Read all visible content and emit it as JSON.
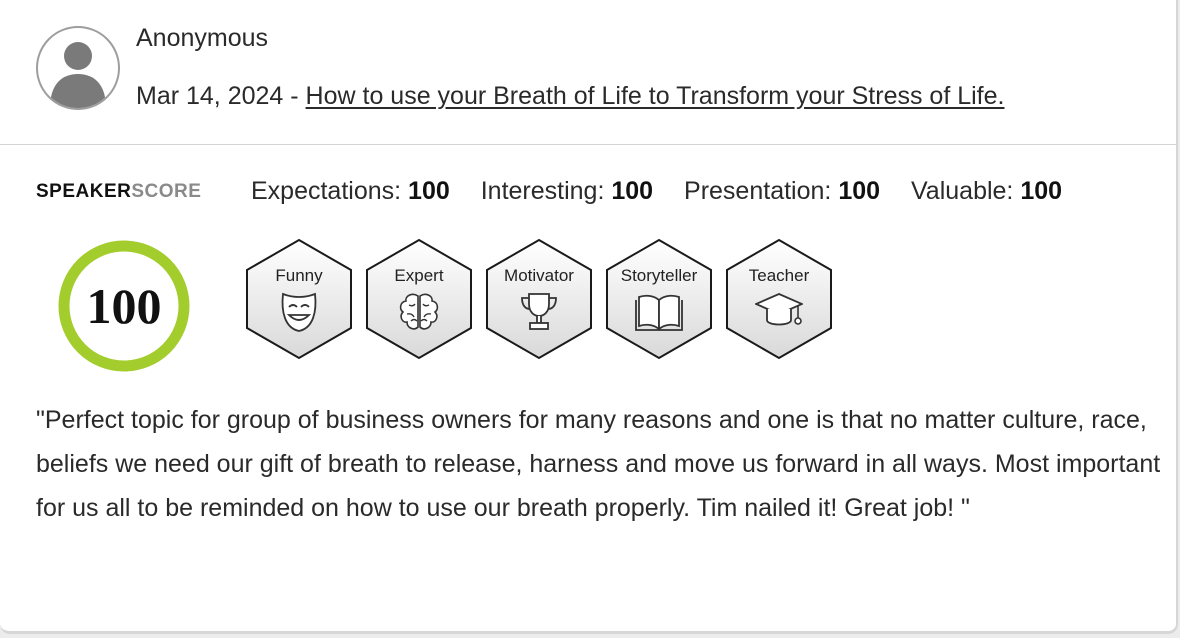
{
  "review": {
    "author": "Anonymous",
    "date": "Mar 14, 2024",
    "separator": " - ",
    "talk_title": "How to use your Breath of Life to Transform your Stress of Life."
  },
  "speakerscore": {
    "brand_part1": "SPEAKER",
    "brand_part2": "SCORE",
    "total": "100",
    "ring_color": "#a3cd2c",
    "metrics": [
      {
        "label": "Expectations:",
        "value": "100"
      },
      {
        "label": "Interesting:",
        "value": "100"
      },
      {
        "label": "Presentation:",
        "value": "100"
      },
      {
        "label": "Valuable:",
        "value": "100"
      }
    ],
    "badges": [
      {
        "label": "Funny",
        "icon": "theater-mask-icon"
      },
      {
        "label": "Expert",
        "icon": "brain-icon"
      },
      {
        "label": "Motivator",
        "icon": "trophy-icon"
      },
      {
        "label": "Storyteller",
        "icon": "open-book-icon"
      },
      {
        "label": "Teacher",
        "icon": "graduation-cap-icon"
      }
    ]
  },
  "comment": "\"Perfect topic for group of business owners for many reasons and one is that no matter culture, race, beliefs we need our gift of breath to release, harness and move us forward in all ways. Most important for us all to be reminded on how to use our breath properly. Tim nailed it! Great job! \""
}
